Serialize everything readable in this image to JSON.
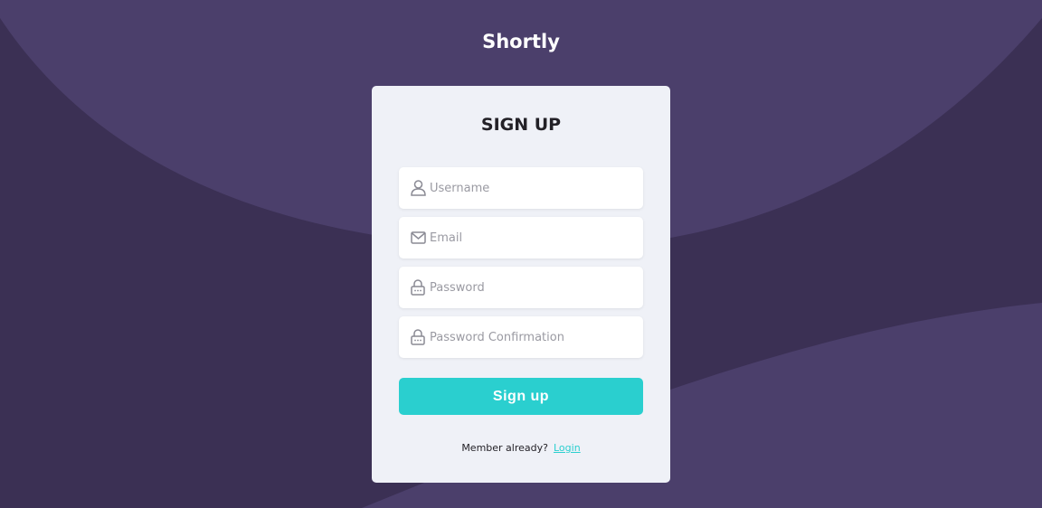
{
  "app": {
    "brand": "Shortly"
  },
  "colors": {
    "background_dark": "#3b3054",
    "background_wave": "#4b3f6b",
    "card": "#eff1f7",
    "accent": "#2acfcf"
  },
  "form": {
    "title": "SIGN UP",
    "fields": [
      {
        "placeholder": "Username",
        "value": "",
        "icon": "user-icon"
      },
      {
        "placeholder": "Email",
        "value": "",
        "icon": "envelope-icon"
      },
      {
        "placeholder": "Password",
        "value": "",
        "icon": "lock-icon"
      },
      {
        "placeholder": "Password Confirmation",
        "value": "",
        "icon": "lock-icon"
      }
    ],
    "submit_label": "Sign up",
    "footer_text": "Member already?",
    "login_link": "Login"
  }
}
